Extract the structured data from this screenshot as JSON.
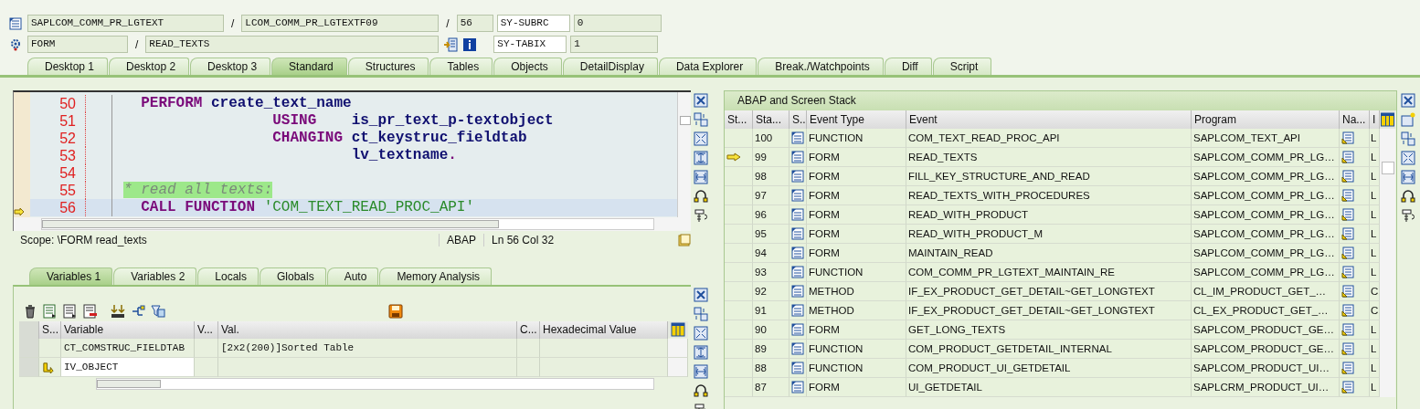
{
  "header": {
    "program": "SAPLCOM_COMM_PR_LGTEXT",
    "separator_1": "/",
    "include": "LCOM_COMM_PR_LGTEXTF09",
    "separator_2": "/",
    "line": "56",
    "sysfield_1": "SY-SUBRC",
    "sysvalue_1": "0",
    "event_type": "FORM",
    "separator_3": "/",
    "event": "READ_TEXTS",
    "sysfield_2": "SY-TABIX",
    "sysvalue_2": "1"
  },
  "tabs": [
    {
      "label": "Desktop 1",
      "selected": false
    },
    {
      "label": "Desktop 2",
      "selected": false
    },
    {
      "label": "Desktop 3",
      "selected": false
    },
    {
      "label": "Standard",
      "selected": true
    },
    {
      "label": "Structures",
      "selected": false
    },
    {
      "label": "Tables",
      "selected": false
    },
    {
      "label": "Objects",
      "selected": false
    },
    {
      "label": "DetailDisplay",
      "selected": false
    },
    {
      "label": "Data Explorer",
      "selected": false
    },
    {
      "label": "Break./Watchpoints",
      "selected": false
    },
    {
      "label": "Diff",
      "selected": false
    },
    {
      "label": "Script",
      "selected": false
    }
  ],
  "editor": {
    "lines": [
      {
        "no": "50",
        "current": false,
        "tokens": [
          {
            "kind": "kw",
            "text": "  PERFORM "
          },
          {
            "kind": "id",
            "text": "create_text_name"
          }
        ]
      },
      {
        "no": "51",
        "current": false,
        "tokens": [
          {
            "kind": "kw",
            "text": "                 USING    "
          },
          {
            "kind": "id",
            "text": "is_pr_text_p-textobject"
          }
        ]
      },
      {
        "no": "52",
        "current": false,
        "tokens": [
          {
            "kind": "kw",
            "text": "                 CHANGING "
          },
          {
            "kind": "id",
            "text": "ct_keystruc_fieldtab"
          }
        ]
      },
      {
        "no": "53",
        "current": false,
        "tokens": [
          {
            "kind": "id",
            "text": "                          lv_textname"
          },
          {
            "kind": "kw",
            "text": "."
          }
        ]
      },
      {
        "no": "54",
        "current": false
      },
      {
        "no": "55",
        "current": false,
        "tokens": [
          {
            "kind": "comment",
            "text": "* read all texts:"
          }
        ]
      },
      {
        "no": "56",
        "current": true,
        "tokens": [
          {
            "kind": "kw",
            "text": "  CALL FUNCTION "
          },
          {
            "kind": "str",
            "text": "'COM_TEXT_READ_PROC_API'"
          }
        ]
      }
    ],
    "status": {
      "scope": "Scope: \\FORM read_texts",
      "language": "ABAP",
      "position": "Ln  56 Col  32"
    }
  },
  "variables": {
    "tabs": [
      {
        "label": "Variables 1",
        "selected": true
      },
      {
        "label": "Variables 2",
        "selected": false
      },
      {
        "label": "Locals",
        "selected": false
      },
      {
        "label": "Globals",
        "selected": false
      },
      {
        "label": "Auto",
        "selected": false
      },
      {
        "label": "Memory Analysis",
        "selected": false
      }
    ],
    "columns": [
      "S...",
      "Variable",
      "V...",
      "Val.",
      "C...",
      "Hexadecimal Value"
    ],
    "rows": [
      {
        "variable": "CT_COMSTRUC_FIELDTAB",
        "value": "[2x2(200)]Sorted Table",
        "flagged": false
      },
      {
        "variable": "IV_OBJECT",
        "flagged": true
      }
    ]
  },
  "stack": {
    "title": "ABAP and Screen Stack",
    "columns": [
      "St...",
      "Sta...",
      "S..",
      "Event Type",
      "Event",
      "Program",
      "Na...",
      "I"
    ],
    "rows": [
      {
        "current": false,
        "stack_no": "100",
        "event_type": "FUNCTION",
        "event": "COM_TEXT_READ_PROC_API",
        "program": "SAPLCOM_TEXT_API",
        "column_9": "L"
      },
      {
        "current": true,
        "stack_no": "99",
        "event_type": "FORM",
        "event": "READ_TEXTS",
        "program": "SAPLCOM_COMM_PR_LG…",
        "column_9": "L"
      },
      {
        "current": false,
        "stack_no": "98",
        "event_type": "FORM",
        "event": "FILL_KEY_STRUCTURE_AND_READ",
        "program": "SAPLCOM_COMM_PR_LG…",
        "column_9": "L"
      },
      {
        "current": false,
        "stack_no": "97",
        "event_type": "FORM",
        "event": "READ_TEXTS_WITH_PROCEDURES",
        "program": "SAPLCOM_COMM_PR_LG…",
        "column_9": "L"
      },
      {
        "current": false,
        "stack_no": "96",
        "event_type": "FORM",
        "event": "READ_WITH_PRODUCT",
        "program": "SAPLCOM_COMM_PR_LG…",
        "column_9": "L"
      },
      {
        "current": false,
        "stack_no": "95",
        "event_type": "FORM",
        "event": "READ_WITH_PRODUCT_M",
        "program": "SAPLCOM_COMM_PR_LG…",
        "column_9": "L"
      },
      {
        "current": false,
        "stack_no": "94",
        "event_type": "FORM",
        "event": "MAINTAIN_READ",
        "program": "SAPLCOM_COMM_PR_LG…",
        "column_9": "L"
      },
      {
        "current": false,
        "stack_no": "93",
        "event_type": "FUNCTION",
        "event": "COM_COMM_PR_LGTEXT_MAINTAIN_RE",
        "program": "SAPLCOM_COMM_PR_LG…",
        "column_9": "L"
      },
      {
        "current": false,
        "stack_no": "92",
        "event_type": "METHOD",
        "event": "IF_EX_PRODUCT_GET_DETAIL~GET_LONGTEXT",
        "program": "CL_IM_PRODUCT_GET_…",
        "column_9": "C"
      },
      {
        "current": false,
        "stack_no": "91",
        "event_type": "METHOD",
        "event": "IF_EX_PRODUCT_GET_DETAIL~GET_LONGTEXT",
        "program": "CL_EX_PRODUCT_GET_…",
        "column_9": "C"
      },
      {
        "current": false,
        "stack_no": "90",
        "event_type": "FORM",
        "event": "GET_LONG_TEXTS",
        "program": "SAPLCOM_PRODUCT_GE…",
        "column_9": "L"
      },
      {
        "current": false,
        "stack_no": "89",
        "event_type": "FUNCTION",
        "event": "COM_PRODUCT_GETDETAIL_INTERNAL",
        "program": "SAPLCOM_PRODUCT_GE…",
        "column_9": "L"
      },
      {
        "current": false,
        "stack_no": "88",
        "event_type": "FUNCTION",
        "event": "COM_PRODUCT_UI_GETDETAIL",
        "program": "SAPLCOM_PRODUCT_UI…",
        "column_9": "L"
      },
      {
        "current": false,
        "stack_no": "87",
        "event_type": "FORM",
        "event": "UI_GETDETAIL",
        "program": "SAPLCRM_PRODUCT_UI…",
        "column_9": "L"
      }
    ]
  }
}
